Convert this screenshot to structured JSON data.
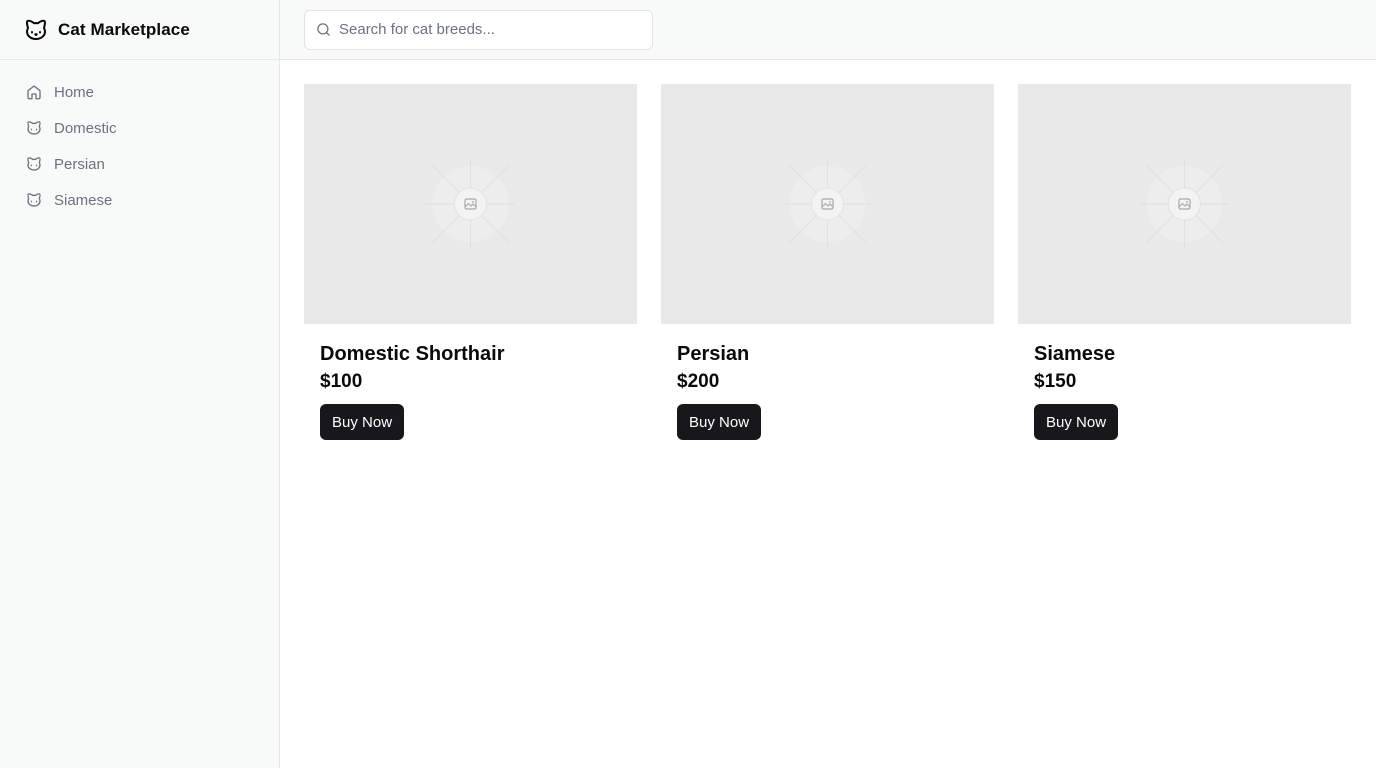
{
  "app": {
    "title": "Cat Marketplace",
    "logo_icon": "cat-icon"
  },
  "sidebar": {
    "items": [
      {
        "label": "Home",
        "icon": "home-icon"
      },
      {
        "label": "Domestic",
        "icon": "cat-icon"
      },
      {
        "label": "Persian",
        "icon": "cat-icon"
      },
      {
        "label": "Siamese",
        "icon": "cat-icon"
      }
    ]
  },
  "search": {
    "placeholder": "Search for cat breeds...",
    "value": ""
  },
  "products": [
    {
      "name": "Domestic Shorthair",
      "price": "$100",
      "button_label": "Buy Now",
      "image_icon": "image-placeholder-icon"
    },
    {
      "name": "Persian",
      "price": "$200",
      "button_label": "Buy Now",
      "image_icon": "image-placeholder-icon"
    },
    {
      "name": "Siamese",
      "price": "$150",
      "button_label": "Buy Now",
      "image_icon": "image-placeholder-icon"
    }
  ],
  "colors": {
    "sidebar_bg": "#f8f9f9",
    "image_placeholder_bg": "#e9e9e9",
    "button_bg": "#18181b",
    "muted_text": "#6b7280"
  }
}
